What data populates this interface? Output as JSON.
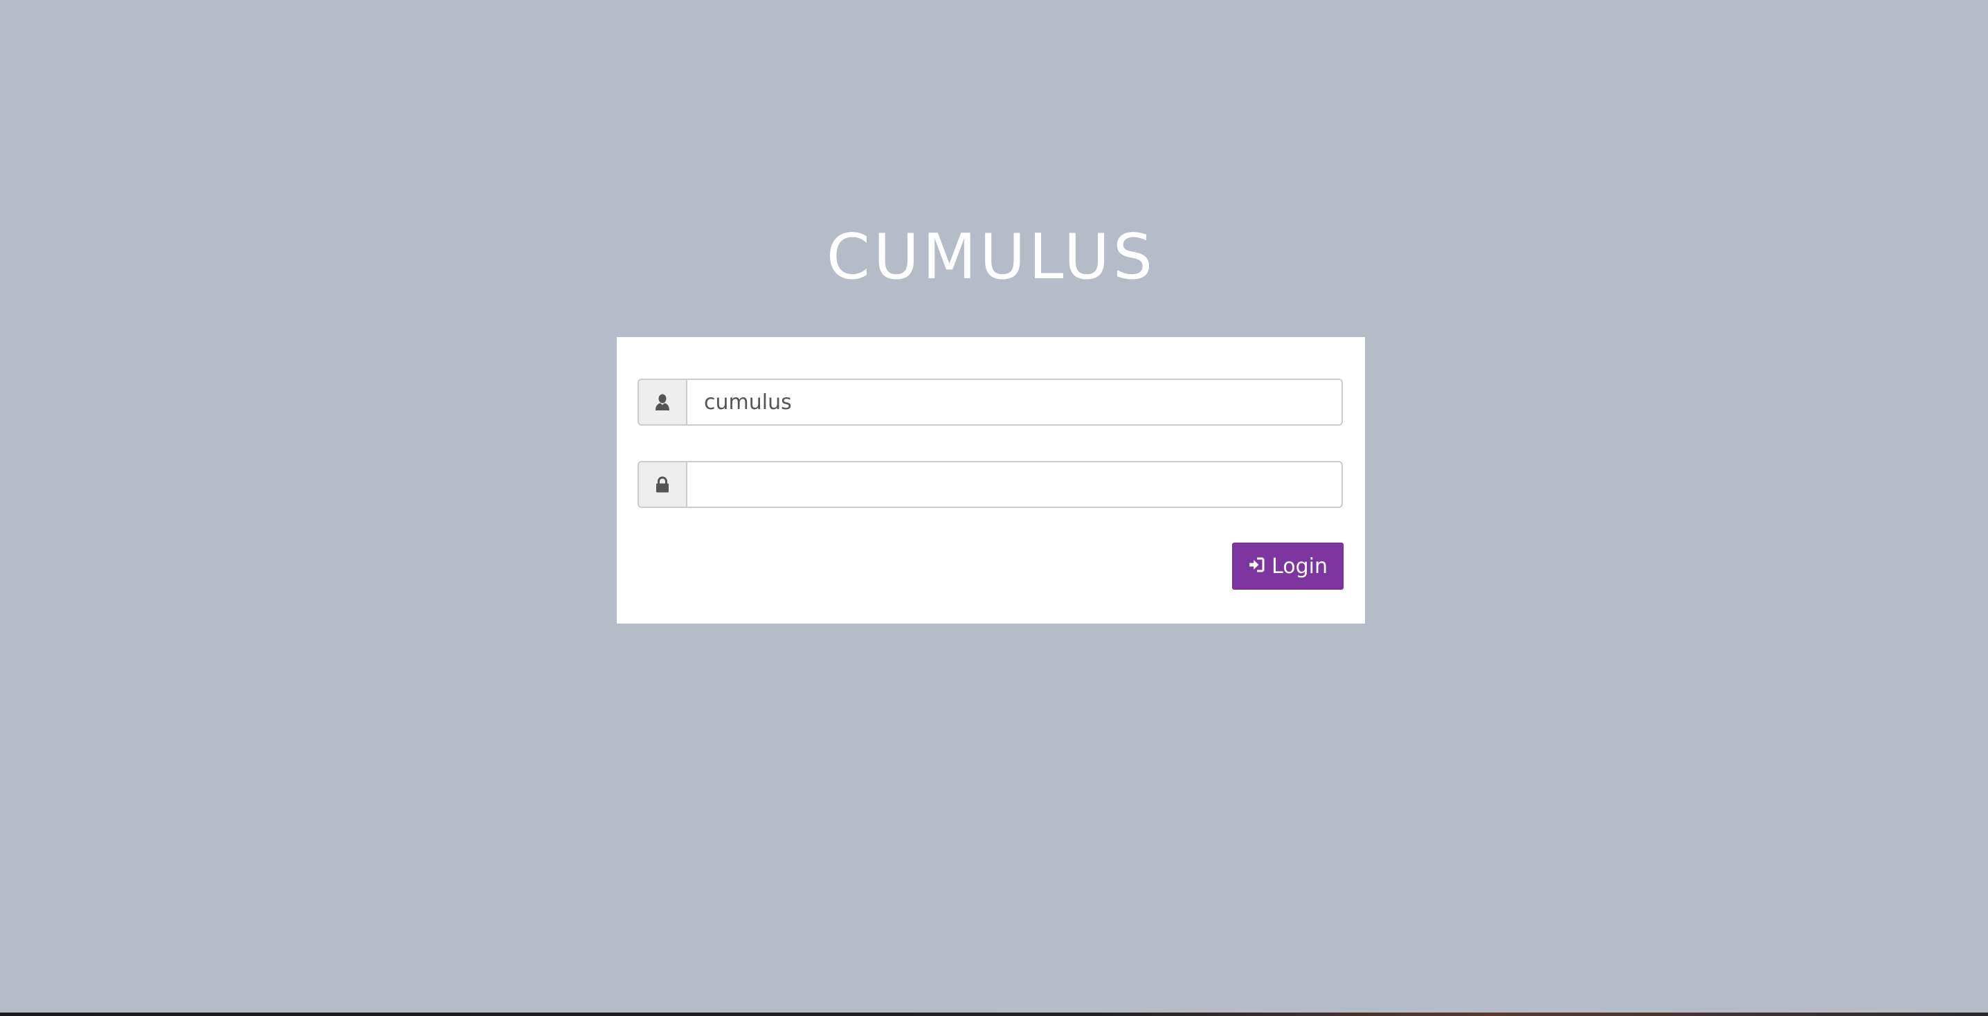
{
  "app": {
    "brand_title": "CUMULUS"
  },
  "login_form": {
    "username": {
      "value": "cumulus",
      "icon": "user-icon"
    },
    "password": {
      "value": "",
      "icon": "lock-icon"
    },
    "submit": {
      "label": "Login",
      "icon": "sign-in-icon"
    }
  },
  "colors": {
    "background": "#b5bcc8",
    "panel": "#ffffff",
    "accent": "#7d35a0",
    "input_border": "#cccccc",
    "addon_bg": "#eeeeee",
    "icon": "#555555"
  }
}
